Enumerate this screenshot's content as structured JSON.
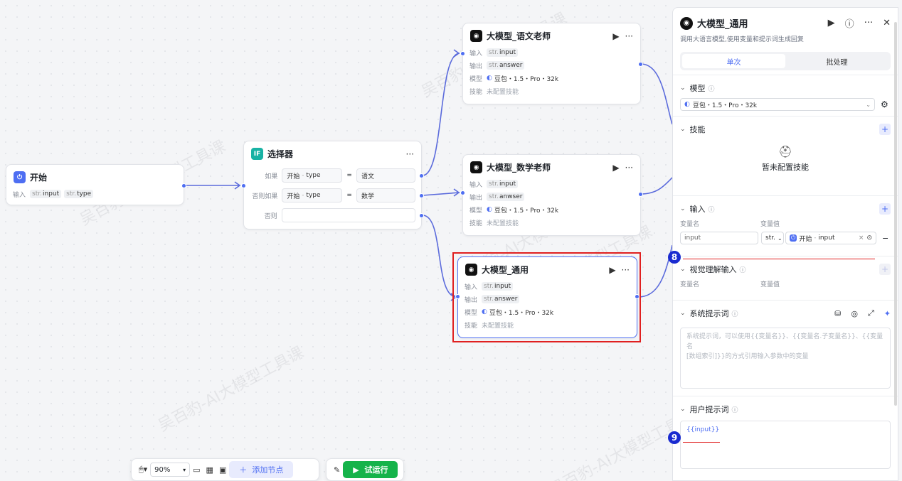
{
  "watermark": "吴百豹-AI大模型工具课",
  "nodes": {
    "start": {
      "title": "开始",
      "input_label": "输入",
      "inputs": [
        {
          "type": "str.",
          "name": "input"
        },
        {
          "type": "str.",
          "name": "type"
        }
      ]
    },
    "selector": {
      "title": "选择器",
      "menu": "···",
      "conditions": [
        {
          "label": "如果",
          "left_source": "开始",
          "left_sep": "-",
          "left_field": "type",
          "op": "=",
          "right": "语文"
        },
        {
          "label": "否则如果",
          "left_source": "开始",
          "left_sep": "-",
          "left_field": "type",
          "op": "=",
          "right": "数学"
        },
        {
          "label": "否则"
        }
      ]
    },
    "llm_chinese": {
      "title": "大模型_语文老师",
      "rows": {
        "in_label": "输入",
        "in_type": "str.",
        "in_name": "input",
        "out_label": "输出",
        "out_type": "str.",
        "out_name": "answer",
        "model_label": "模型",
        "model": "豆包・1.5・Pro・32k",
        "skill_label": "技能",
        "skill": "未配置技能"
      }
    },
    "llm_math": {
      "title": "大模型_数学老师",
      "rows": {
        "in_label": "输入",
        "in_type": "str.",
        "in_name": "input",
        "out_label": "输出",
        "out_type": "str.",
        "out_name": "anwser",
        "model_label": "模型",
        "model": "豆包・1.5・Pro・32k",
        "skill_label": "技能",
        "skill": "未配置技能"
      }
    },
    "llm_general": {
      "title": "大模型_通用",
      "rows": {
        "in_label": "输入",
        "in_type": "str.",
        "in_name": "input",
        "out_label": "输出",
        "out_type": "str.",
        "out_name": "answer",
        "model_label": "模型",
        "model": "豆包・1.5・Pro・32k",
        "skill_label": "技能",
        "skill": "未配置技能"
      }
    }
  },
  "node_actions": {
    "run": "▶",
    "more": "···"
  },
  "toolbar": {
    "zoom": "90%",
    "add_node": "添加节点",
    "run": "试运行"
  },
  "panel": {
    "title": "大模型_通用",
    "description": "调用大语言模型,使用变量和提示词生成回复",
    "tabs": [
      {
        "label": "单次",
        "active": true
      },
      {
        "label": "批处理",
        "active": false
      }
    ],
    "model": {
      "label": "模型",
      "value": "豆包・1.5・Pro・32k"
    },
    "skills": {
      "label": "技能",
      "empty": "暂未配置技能"
    },
    "input": {
      "label": "输入",
      "col_name": "变量名",
      "col_value": "变量值",
      "var_name": "input",
      "type": "str.",
      "ref_source": "开始",
      "ref_sep": "-",
      "ref_field": "input"
    },
    "vision": {
      "label": "视觉理解输入",
      "col_name": "变量名",
      "col_value": "变量值"
    },
    "system_prompt": {
      "label": "系统提示词",
      "placeholder_line1": "系统提示词，可以使用{{变量名}}、{{变量名.子变量名}}、{{变量名",
      "placeholder_line2": "[数组索引]}}的方式引用输入参数中的变量"
    },
    "user_prompt": {
      "label": "用户提示词",
      "value": "{{input}}"
    }
  },
  "annotations": {
    "badge_a": "8",
    "badge_b": "9",
    "color": "#e02020"
  },
  "colors": {
    "accent": "#4e6ef2",
    "run_green": "#15b34a",
    "badge_blue": "#1a2bd0"
  }
}
